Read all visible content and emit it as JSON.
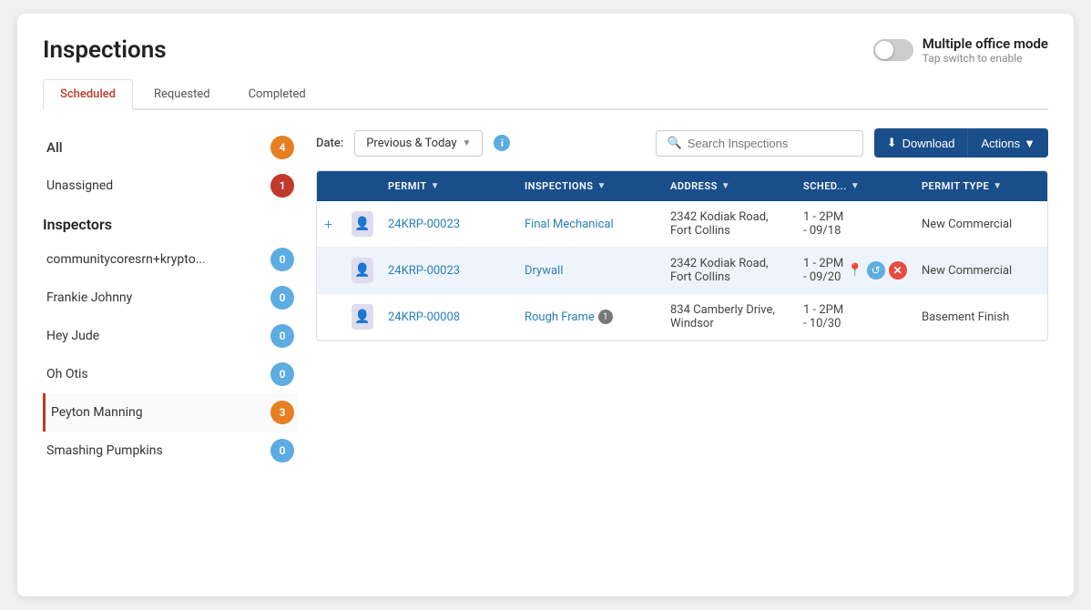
{
  "page": {
    "title": "Inspections"
  },
  "multiple_office": {
    "title": "Multiple office mode",
    "subtitle": "Tap switch to enable"
  },
  "tabs": [
    {
      "label": "Scheduled",
      "active": true
    },
    {
      "label": "Requested",
      "active": false
    },
    {
      "label": "Completed",
      "active": false
    }
  ],
  "sidebar": {
    "all_label": "All",
    "all_count": "4",
    "unassigned_label": "Unassigned",
    "unassigned_count": "1",
    "inspectors_header": "Inspectors",
    "inspectors": [
      {
        "name": "communitycoresrn+krypto...",
        "count": "0",
        "badge_type": "blue2",
        "selected": false
      },
      {
        "name": "Frankie Johnny",
        "count": "0",
        "badge_type": "blue2",
        "selected": false
      },
      {
        "name": "Hey Jude",
        "count": "0",
        "badge_type": "blue2",
        "selected": false
      },
      {
        "name": "Oh Otis",
        "count": "0",
        "badge_type": "blue2",
        "selected": false
      },
      {
        "name": "Peyton Manning",
        "count": "3",
        "badge_type": "orange",
        "selected": true
      },
      {
        "name": "Smashing Pumpkins",
        "count": "0",
        "badge_type": "blue2",
        "selected": false
      }
    ]
  },
  "toolbar": {
    "date_label": "Date:",
    "date_value": "Previous & Today",
    "search_placeholder": "Search Inspections",
    "download_label": "Download",
    "actions_label": "Actions"
  },
  "table": {
    "columns": [
      {
        "key": "plus",
        "label": ""
      },
      {
        "key": "avatar",
        "label": ""
      },
      {
        "key": "permit",
        "label": "PERMIT"
      },
      {
        "key": "inspections",
        "label": "INSPECTIONS"
      },
      {
        "key": "address",
        "label": "ADDRESS"
      },
      {
        "key": "sched",
        "label": "SCHED..."
      },
      {
        "key": "permit_type",
        "label": "PERMIT TYPE"
      }
    ],
    "rows": [
      {
        "has_plus": true,
        "permit": "24KRP-00023",
        "inspection": "Final Mechanical",
        "address_line1": "2342 Kodiak Road,",
        "address_line2": "Fort Collins",
        "sched_time": "1 - 2PM",
        "sched_date": "- 09/18",
        "permit_type": "New Commercial",
        "highlighted": false,
        "has_pin": false,
        "has_undo": false,
        "has_x": false,
        "notif": null
      },
      {
        "has_plus": false,
        "permit": "24KRP-00023",
        "inspection": "Drywall",
        "address_line1": "2342 Kodiak Road,",
        "address_line2": "Fort Collins",
        "sched_time": "1 - 2PM",
        "sched_date": "- 09/20",
        "permit_type": "New Commercial",
        "highlighted": true,
        "has_pin": true,
        "has_undo": true,
        "has_x": true,
        "notif": null
      },
      {
        "has_plus": false,
        "permit": "24KRP-00008",
        "inspection": "Rough Frame",
        "address_line1": "834 Camberly Drive,",
        "address_line2": "Windsor",
        "sched_time": "1 - 2PM",
        "sched_date": "- 10/30",
        "permit_type": "Basement Finish",
        "highlighted": false,
        "has_pin": false,
        "has_undo": false,
        "has_x": false,
        "notif": "1"
      }
    ]
  }
}
